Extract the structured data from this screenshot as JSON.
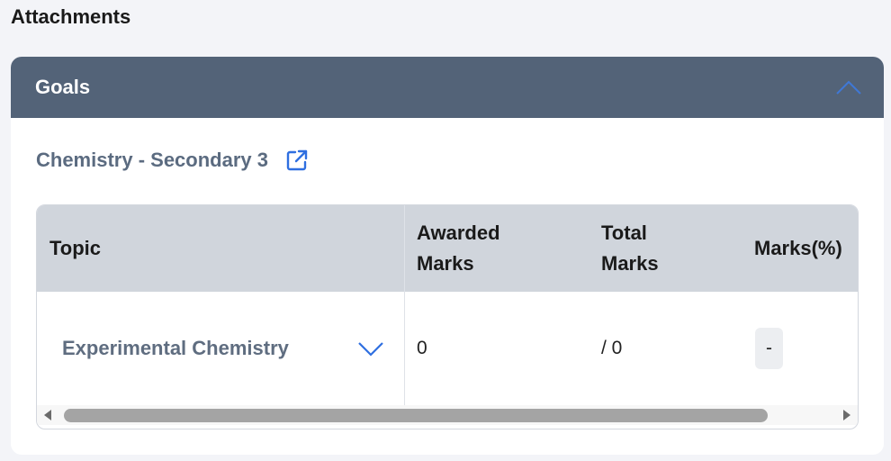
{
  "page": {
    "section_title": "Attachments"
  },
  "goals_card": {
    "header_title": "Goals",
    "collapse_icon": "chevron-up-icon",
    "subject_link": "Chemistry - Secondary 3",
    "subject_link_icon": "external-link-icon",
    "header_color": "#536378",
    "link_icon_color": "#2f6fe0"
  },
  "table": {
    "columns": {
      "topic": "Topic",
      "awarded": "Awarded\nMarks",
      "total": "Total\nMarks",
      "marks_pct": "Marks(%)"
    },
    "rows": [
      {
        "topic": "Experimental Chemistry",
        "expand_icon": "chevron-down-icon",
        "awarded": "0",
        "total": "/ 0",
        "marks_pct": "-"
      }
    ],
    "scroll_fraction": 0.0
  }
}
